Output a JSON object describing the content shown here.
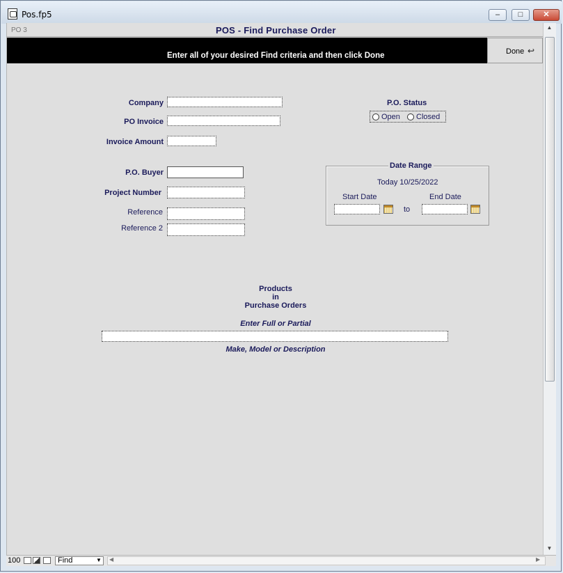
{
  "window": {
    "title": "Pos.fp5",
    "minimize": "–",
    "maximize": "□",
    "close": "✕"
  },
  "header": {
    "record": "PO  3",
    "title": "POS - Find Purchase Order"
  },
  "instruction": "Enter all of your desired Find criteria and then click Done",
  "done": {
    "label": "Done",
    "icon": "return-arrow-icon",
    "glyph": "↩"
  },
  "fields": {
    "company": {
      "label": "Company",
      "value": ""
    },
    "po_invoice": {
      "label": "PO Invoice",
      "value": ""
    },
    "invoice_amount": {
      "label": "Invoice Amount",
      "value": ""
    },
    "po_buyer": {
      "label": "P.O. Buyer",
      "value": ""
    },
    "project_number": {
      "label": "Project Number",
      "value": ""
    },
    "reference": {
      "label": "Reference",
      "value": ""
    },
    "reference2": {
      "label": "Reference 2",
      "value": ""
    }
  },
  "status": {
    "title": "P.O. Status",
    "options": [
      "Open",
      "Closed"
    ]
  },
  "date_range": {
    "title": "Date Range",
    "today": "Today 10/25/2022",
    "start_label": "Start Date",
    "end_label": "End Date",
    "to": "to"
  },
  "products": {
    "line1": "Products",
    "line2": "in",
    "line3": "Purchase Orders",
    "hint_top": "Enter Full or Partial",
    "hint_bottom": "Make, Model or Description",
    "value": ""
  },
  "statusbar": {
    "zoom": "100",
    "mode": "Find"
  }
}
